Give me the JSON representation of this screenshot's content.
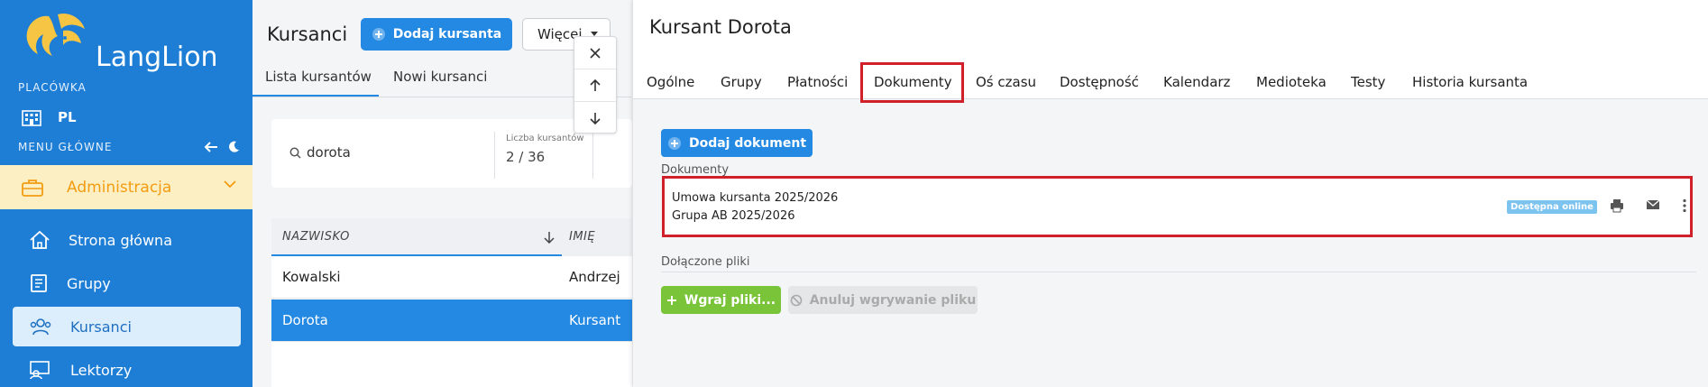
{
  "colors": {
    "sidebar": "#1e7ed6",
    "accent": "#2489e3",
    "admin_bg": "#fdefc4",
    "admin_fg": "#f39c12",
    "highlight": "#d0202a",
    "upload": "#7ac43a",
    "badge": "#7cc3f0"
  },
  "sidebar": {
    "logo_text": "LangLion",
    "branch_section": "PLACÓWKA",
    "branch_name": "PL",
    "menu_section": "MENU GŁÓWNE",
    "admin_label": "Administracja",
    "items": [
      {
        "label": "Strona główna",
        "icon": "home-icon"
      },
      {
        "label": "Grupy",
        "icon": "book-icon"
      },
      {
        "label": "Kursanci",
        "icon": "users-icon"
      },
      {
        "label": "Lektorzy",
        "icon": "teacher-icon"
      }
    ]
  },
  "list": {
    "title": "Kursanci",
    "add_button": "Dodaj kursanta",
    "more_button": "Więcej",
    "tabs": [
      "Lista kursantów",
      "Nowi kursanci"
    ],
    "search_value": "dorota",
    "count_label": "Liczba kursantów",
    "count_value": "2 / 36",
    "columns": [
      "NAZWISKO",
      "IMIĘ"
    ],
    "rows": [
      {
        "surname": "Kowalski",
        "name": "Andrzej"
      },
      {
        "surname": "Dorota",
        "name": "Kursant"
      }
    ]
  },
  "detail": {
    "title": "Kursant Dorota",
    "tabs": [
      "Ogólne",
      "Grupy",
      "Płatności",
      "Dokumenty",
      "Oś czasu",
      "Dostępność",
      "Kalendarz",
      "Medioteka",
      "Testy",
      "Historia kursanta"
    ],
    "active_tab": "Dokumenty",
    "add_doc_button": "Dodaj dokument",
    "documents_label": "Dokumenty",
    "document": {
      "line1": "Umowa kursanta 2025/2026",
      "line2": "Grupa AB 2025/2026",
      "badge": "Dostępna online"
    },
    "attached_label": "Dołączone pliki",
    "upload_button": "Wgraj pliki...",
    "cancel_button": "Anuluj wgrywanie pliku"
  }
}
